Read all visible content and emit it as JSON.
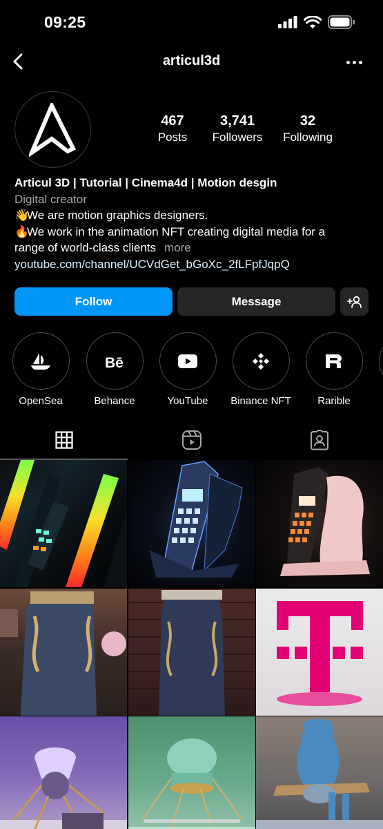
{
  "status_bar": {
    "time": "09:25"
  },
  "nav": {
    "title": "articul3d"
  },
  "stats": [
    {
      "value": "467",
      "label": "Posts"
    },
    {
      "value": "3,741",
      "label": "Followers"
    },
    {
      "value": "32",
      "label": "Following"
    }
  ],
  "bio": {
    "name": "Articul 3D | Tutorial | Cinema4d | Motion desgin",
    "category": "Digital creator",
    "line1_emoji": "👋",
    "line1": "We are motion graphics designers.",
    "line2_emoji": "🔥",
    "line2": "We work in the animation NFT creating digital media for a",
    "line3": "range of world-class clients",
    "more": "more",
    "link": "youtube.com/channel/UCVdGet_bGoXc_2fLFpfJqpQ"
  },
  "buttons": {
    "follow": "Follow",
    "message": "Message"
  },
  "highlights": [
    {
      "label": "OpenSea",
      "icon": "opensea-icon"
    },
    {
      "label": "Behance",
      "icon": "behance-icon"
    },
    {
      "label": "YouTube",
      "icon": "youtube-icon"
    },
    {
      "label": "Binance NFT",
      "icon": "binance-icon"
    },
    {
      "label": "Rarible",
      "icon": "rarible-icon"
    }
  ],
  "tabs": [
    {
      "name": "posts-grid",
      "icon": "grid-icon",
      "active": true
    },
    {
      "name": "reels",
      "icon": "reels-icon",
      "active": false
    },
    {
      "name": "tagged",
      "icon": "tagged-icon",
      "active": false
    }
  ],
  "colors": {
    "follow": "#0095f6",
    "magenta": "#e20074",
    "background": "#000000"
  }
}
